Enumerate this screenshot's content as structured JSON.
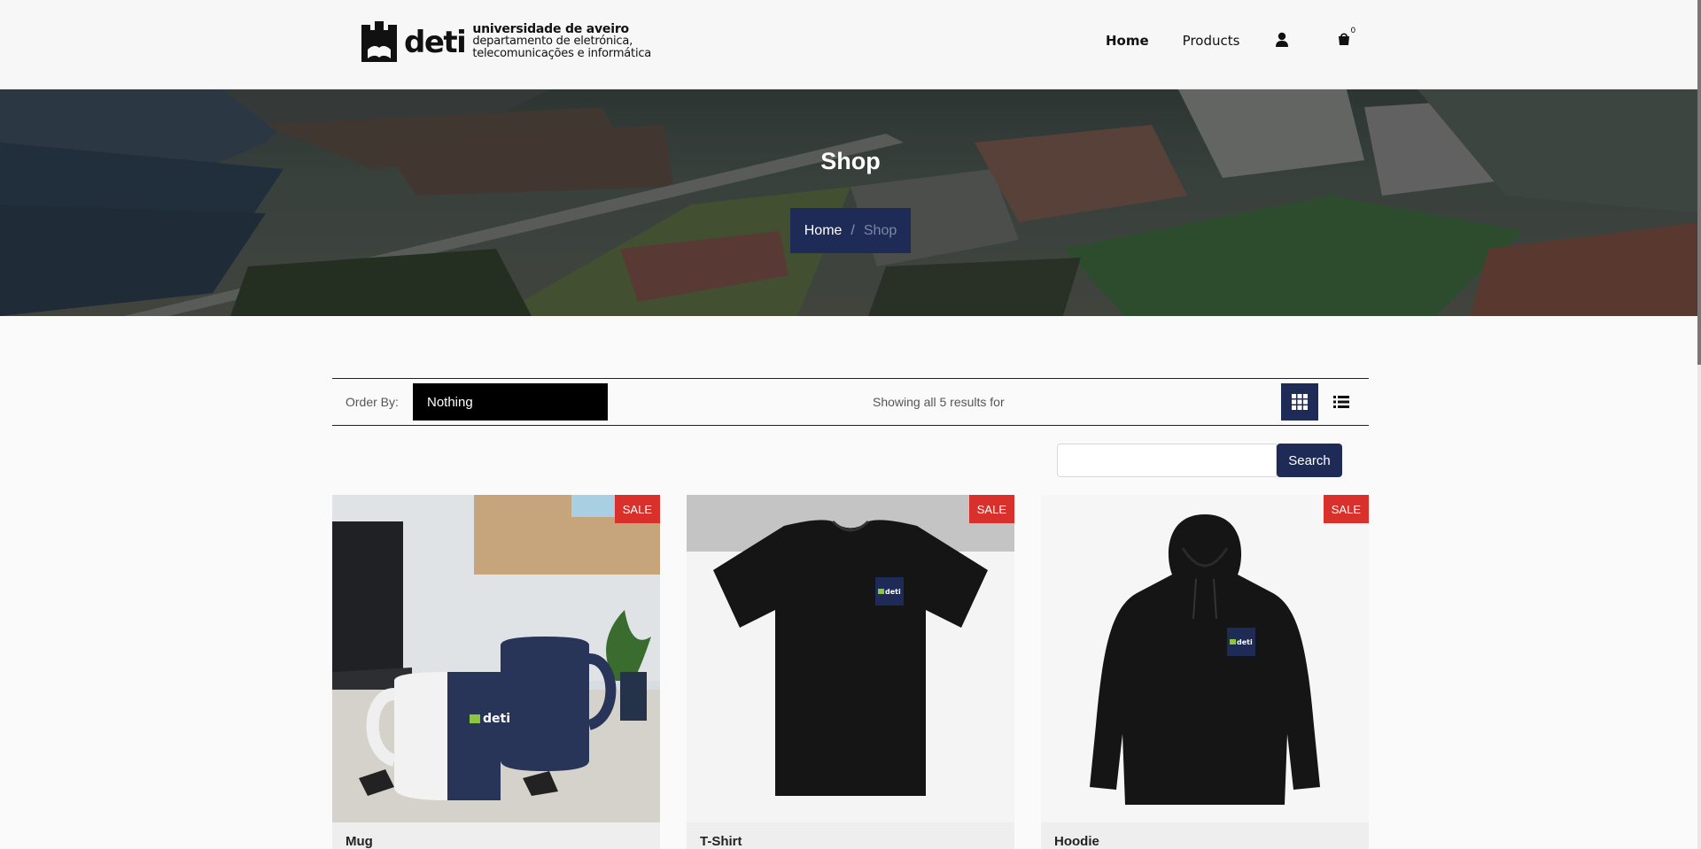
{
  "header": {
    "logo": {
      "short": "deti",
      "line1": "universidade de aveiro",
      "line2": "departamento de eletrónica,",
      "line3": "telecomunicações e informática"
    },
    "nav": {
      "home": "Home",
      "products": "Products",
      "cart_count": "0"
    }
  },
  "hero": {
    "title": "Shop",
    "breadcrumb": {
      "home": "Home",
      "separator": "/",
      "current": "Shop"
    }
  },
  "toolbar": {
    "order_label": "Order By:",
    "order_value": "Nothing",
    "showing_text": "Showing all 5 results for"
  },
  "search": {
    "button": "Search",
    "value": ""
  },
  "products": [
    {
      "name": "Mug",
      "badge": "SALE"
    },
    {
      "name": "T-Shirt",
      "badge": "SALE"
    },
    {
      "name": "Hoodie",
      "badge": "SALE"
    }
  ],
  "colors": {
    "primary": "#1f2b57",
    "sale": "#d9302c",
    "logo_green": "#8cc63f"
  },
  "icons": [
    "user-icon",
    "cart-icon",
    "grid-view-icon",
    "list-view-icon"
  ]
}
